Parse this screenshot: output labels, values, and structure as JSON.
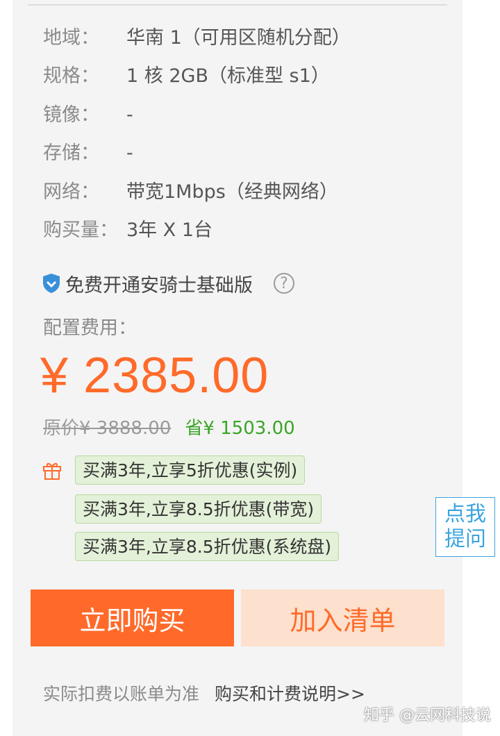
{
  "specs": [
    {
      "label": "地域：",
      "value": "华南 1（可用区随机分配）"
    },
    {
      "label": "规格：",
      "value": "1 核 2GB（标准型 s1）"
    },
    {
      "label": "镜像：",
      "value": "-"
    },
    {
      "label": "存储：",
      "value": "-"
    },
    {
      "label": "网络：",
      "value": "带宽1Mbps（经典网络）"
    },
    {
      "label": "购买量：",
      "value": "3年 X 1台"
    }
  ],
  "guard": {
    "text": "免费开通安骑士基础版",
    "help": "?",
    "icon": "shield-icon"
  },
  "fee": {
    "label": "配置费用：",
    "price": "¥ 2385.00",
    "original": "原价¥ 3888.00",
    "saving": "省¥ 1503.00"
  },
  "promotions": [
    "买满3年,立享5折优惠(实例)",
    "买满3年,立享8.5折优惠(带宽)",
    "买满3年,立享8.5折优惠(系统盘)"
  ],
  "ask": {
    "line1": "点我",
    "line2": "提问"
  },
  "buttons": {
    "buy": "立即购买",
    "cart": "加入清单"
  },
  "footer": {
    "note": "实际扣费以账单为准",
    "link": "购买和计费说明>>"
  },
  "watermark": "知乎 @云网科技说",
  "colors": {
    "accent": "#ff6a2a",
    "saving": "#3aa526",
    "ask": "#3aa4de",
    "promo_bg": "#e4f1d9"
  }
}
